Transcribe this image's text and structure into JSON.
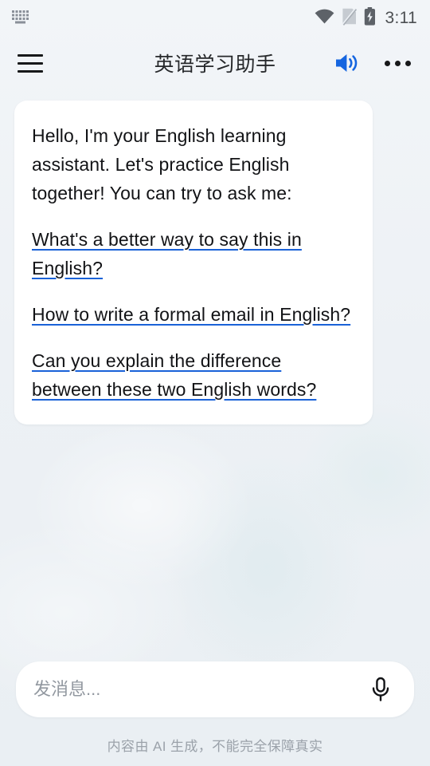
{
  "status_bar": {
    "ime_icon": "keyboard-icon",
    "wifi_icon": "wifi-icon",
    "sim_icon": "no-sim-icon",
    "battery_icon": "battery-charging-icon",
    "clock": "3:11"
  },
  "app_bar": {
    "menu_icon": "hamburger-menu-icon",
    "title": "英语学习助手",
    "speaker_icon": "speaker-on-icon",
    "overflow_icon": "more-horizontal-icon"
  },
  "conversation": {
    "assistant_message": {
      "intro": "Hello, I'm your English learning assistant. Let's practice English together! You can try to ask me:",
      "suggestions": [
        "What's a better way to say this in English?",
        "How to write a formal email in English?",
        "Can you explain the difference between these two English words?"
      ]
    }
  },
  "composer": {
    "input_value": "",
    "input_placeholder": "发消息...",
    "mic_icon": "microphone-icon",
    "disclaimer": "内容由 AI 生成，不能完全保障真实"
  },
  "colors": {
    "page_background": "#eef2f6",
    "card_background": "#ffffff",
    "accent_blue": "#1a62d8",
    "speaker_blue": "#1565e0",
    "text_primary": "#121316",
    "text_muted": "#9ba2aa"
  }
}
